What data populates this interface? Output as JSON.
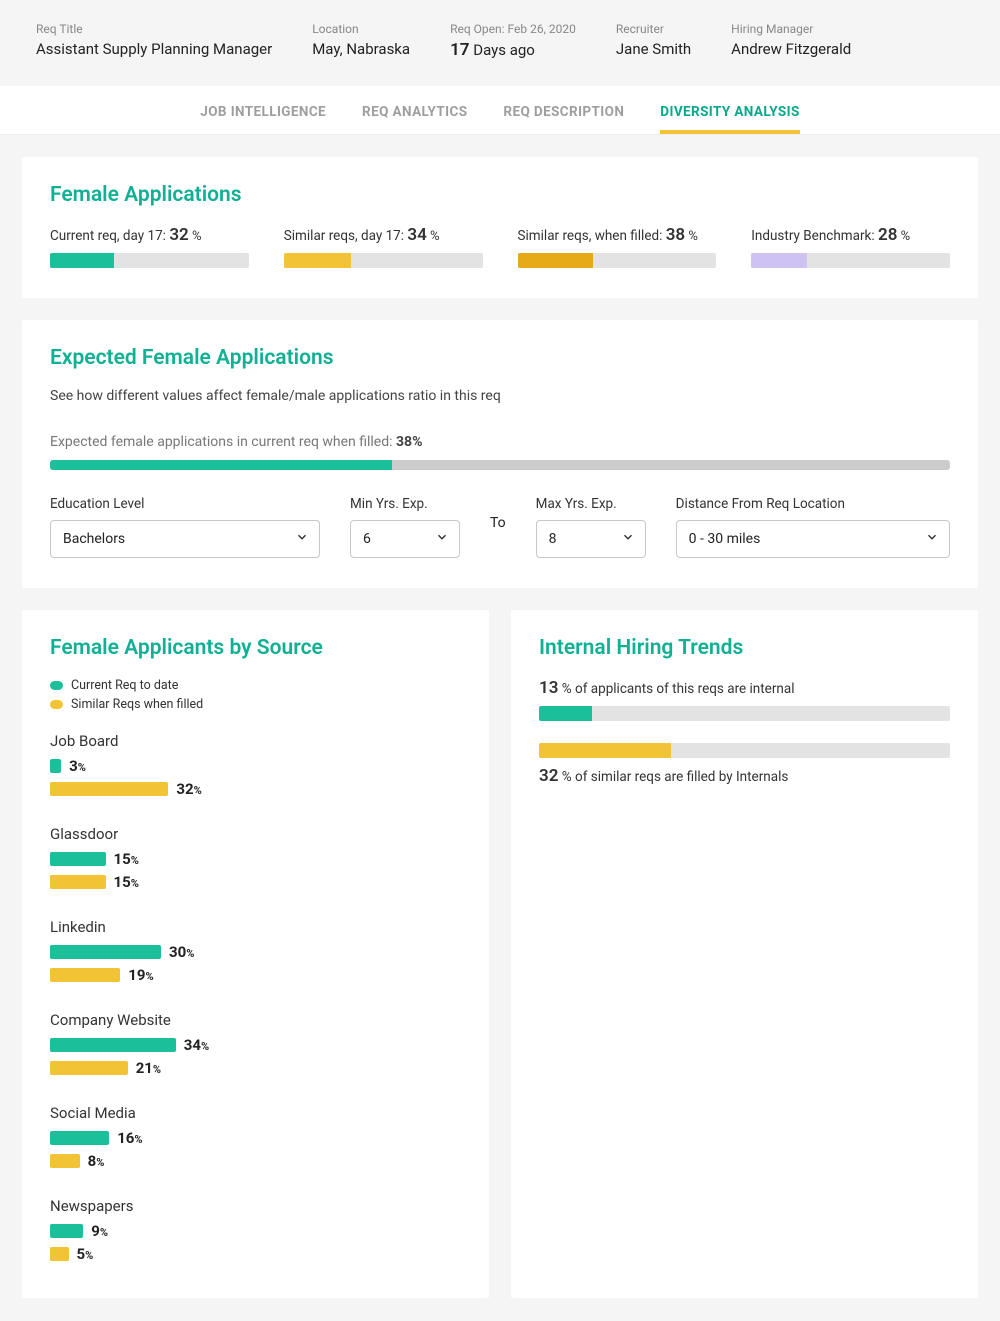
{
  "header": {
    "req_title_label": "Req Title",
    "req_title": "Assistant Supply Planning Manager",
    "location_label": "Location",
    "location": "May, Nabraska",
    "req_open_label": "Req Open: Feb 26, 2020",
    "req_open_days": "17",
    "req_open_suffix": " Days ago",
    "recruiter_label": "Recruiter",
    "recruiter": "Jane Smith",
    "hmanager_label": "Hiring Manager",
    "hmanager": "Andrew Fitzgerald"
  },
  "tabs": {
    "t1": "JOB INTELLIGENCE",
    "t2": "REQ ANALYTICS",
    "t3": "REQ DESCRIPTION",
    "t4": "DIVERSITY ANALYSIS"
  },
  "female_apps": {
    "title": "Female Applications",
    "items": [
      {
        "label": "Current req, day 17:",
        "value": "32",
        "pct": 32,
        "color": "teal"
      },
      {
        "label": "Similar reqs, day 17:",
        "value": "34",
        "pct": 34,
        "color": "yellow"
      },
      {
        "label": "Similar reqs, when filled:",
        "value": "38",
        "pct": 38,
        "color": "gold"
      },
      {
        "label": "Industry Benchmark:",
        "value": "28",
        "pct": 28,
        "color": "lilac"
      }
    ],
    "percent_sign": " %"
  },
  "expected": {
    "title": "Expected Female Applications",
    "subtitle": "See how different values affect female/male applications ratio in this req",
    "line_prefix": "Expected female applications in current req when filled: ",
    "line_value": "38%",
    "bar_pct": 38,
    "education_label": "Education Level",
    "education_value": "Bachelors",
    "min_label": "Min Yrs. Exp.",
    "min_value": "6",
    "to": "To",
    "max_label": "Max Yrs. Exp.",
    "max_value": "8",
    "distance_label": "Distance From Req Location",
    "distance_value": "0 - 30 miles"
  },
  "sources": {
    "title": "Female Applicants by Source",
    "legend1": "Current Req to date",
    "legend2": "Similar Reqs when filled",
    "items": [
      {
        "name": "Job Board",
        "current": 3,
        "similar": 32
      },
      {
        "name": "Glassdoor",
        "current": 15,
        "similar": 15
      },
      {
        "name": "Linkedin",
        "current": 30,
        "similar": 19
      },
      {
        "name": "Company Website",
        "current": 34,
        "similar": 21
      },
      {
        "name": "Social Media",
        "current": 16,
        "similar": 8
      },
      {
        "name": "Newspapers",
        "current": 9,
        "similar": 5
      }
    ]
  },
  "internal": {
    "title": "Internal Hiring Trends",
    "line1_num": "13",
    "line1_rest": " % of applicants of this reqs are internal",
    "bar1_pct": 13,
    "line2_num": "32",
    "line2_rest": " % of similar reqs are filled by Internals",
    "bar2_pct": 32
  },
  "chart_data": [
    {
      "type": "bar",
      "title": "Female Applications",
      "categories": [
        "Current req, day 17",
        "Similar reqs, day 17",
        "Similar reqs, when filled",
        "Industry Benchmark"
      ],
      "values": [
        32,
        34,
        38,
        28
      ],
      "ylabel": "%",
      "ylim": [
        0,
        100
      ]
    },
    {
      "type": "bar",
      "title": "Female Applicants by Source",
      "categories": [
        "Job Board",
        "Glassdoor",
        "Linkedin",
        "Company Website",
        "Social Media",
        "Newspapers"
      ],
      "series": [
        {
          "name": "Current Req to date",
          "values": [
            3,
            15,
            30,
            34,
            16,
            9
          ]
        },
        {
          "name": "Similar Reqs when filled",
          "values": [
            32,
            15,
            19,
            21,
            8,
            5
          ]
        }
      ],
      "xlabel": "",
      "ylabel": "%",
      "ylim": [
        0,
        100
      ]
    },
    {
      "type": "bar",
      "title": "Internal Hiring Trends",
      "categories": [
        "Applicants of this req that are internal",
        "Similar reqs filled by Internals"
      ],
      "values": [
        13,
        32
      ],
      "ylabel": "%",
      "ylim": [
        0,
        100
      ]
    }
  ]
}
